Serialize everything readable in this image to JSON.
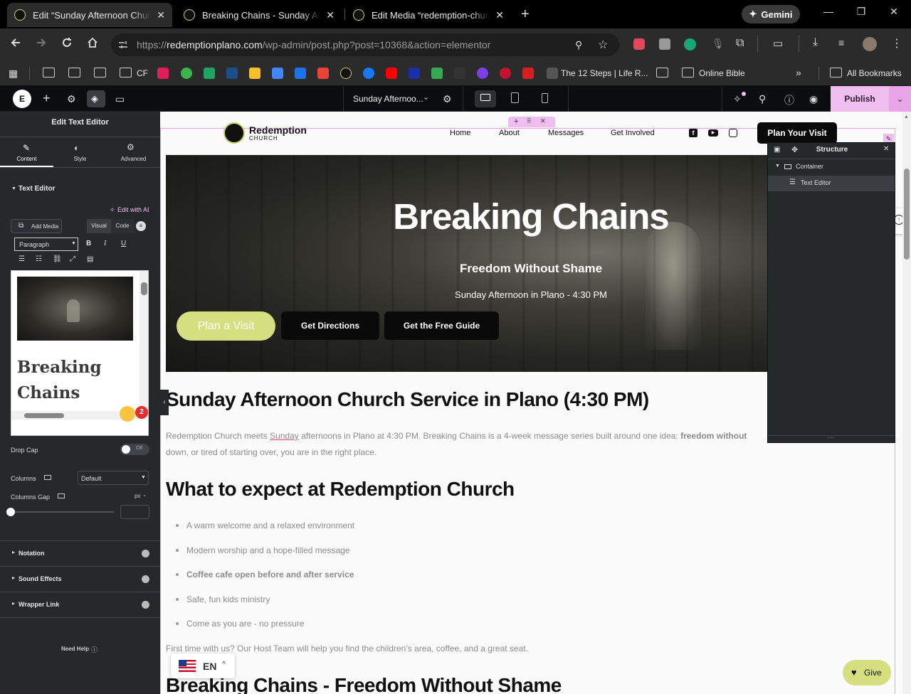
{
  "browser": {
    "tabs": [
      {
        "title": "Edit “Sunday Afternoon Church"
      },
      {
        "title": "Breaking Chains - Sunday After"
      },
      {
        "title": "Edit Media “redemption-church"
      }
    ],
    "gemini_label": "Gemini",
    "url_prefix": "https://",
    "url_domain": "redemptionplano.com",
    "url_path": "/wp-admin/post.php?post=10368&action=elementor",
    "bookmarks": {
      "cf_label": "CF",
      "twelve_steps": "The 12 Steps | Life R...",
      "online_bible": "Online Bible",
      "all_bookmarks": "All Bookmarks"
    }
  },
  "elementor": {
    "page_title": "Sunday Afternoo...",
    "publish_label": "Publish",
    "panel": {
      "title": "Edit Text Editor",
      "tabs": [
        {
          "label": "Content"
        },
        {
          "label": "Style"
        },
        {
          "label": "Advanced"
        }
      ],
      "section_title": "Text Editor",
      "edit_with_ai": "Edit with AI",
      "add_media": "Add Media",
      "visual_tab": "Visual",
      "code_tab": "Code",
      "format_select": "Paragraph",
      "preview_heading_line1": "Breaking",
      "preview_heading_line2": "Chains",
      "drop_cap_label": "Drop Cap",
      "drop_cap_toggle": "Off",
      "columns_label": "Columns",
      "columns_value": "Default",
      "columns_gap_label": "Columns Gap",
      "columns_gap_unit": "px",
      "sections": [
        {
          "label": "Notation"
        },
        {
          "label": "Sound Effects"
        },
        {
          "label": "Wrapper Link"
        }
      ],
      "need_help": "Need Help"
    },
    "structure": {
      "title": "Structure",
      "items": [
        {
          "label": "Container"
        },
        {
          "label": "Text Editor"
        }
      ]
    }
  },
  "site": {
    "logo_main": "Redemption",
    "logo_sub": "CHURCH",
    "nav": [
      {
        "label": "Home"
      },
      {
        "label": "About"
      },
      {
        "label": "Messages"
      },
      {
        "label": "Get Involved"
      }
    ],
    "cta": "Plan Your Visit",
    "hero": {
      "title": "Breaking Chains",
      "subtitle": "Freedom Without Shame",
      "time": "Sunday Afternoon in Plano - 4:30 PM",
      "buttons": [
        {
          "label": "Plan a Visit"
        },
        {
          "label": "Get Directions"
        },
        {
          "label": "Get the Free Guide"
        }
      ]
    },
    "h1": "Sunday Afternoon Church Service in Plano (4:30 PM)",
    "intro_line1_a": "Redemption Church meets ",
    "intro_line1_underlined": "Sunday",
    "intro_line1_b": " afternoons in Plano at 4:30 PM. Breaking Chains is a 4-week message series built around one idea: ",
    "intro_line1_bold": "freedom without",
    "intro_line2": "down, or tired of starting over, you are in the right place.",
    "h2_expect": "What to expect at Redemption Church",
    "expect_items": [
      {
        "label": "A warm welcome and a relaxed environment"
      },
      {
        "label": "Modern worship and a hope-filled message"
      },
      {
        "label": "Coffee cafe open before and after service"
      },
      {
        "label": "Safe, fun kids ministry"
      },
      {
        "label": "Come as you are - no pressure"
      }
    ],
    "first_time": "First time with us? Our Host Team will help you find the children’s area, coffee, and a great seat.",
    "h2_series": "Breaking Chains - Freedom Without Shame",
    "language": "EN",
    "give": "Give"
  },
  "colors": {
    "accent_pink": "#f0bdf0",
    "hero_green": "#d5df7f",
    "panel_bg": "#26292c"
  }
}
